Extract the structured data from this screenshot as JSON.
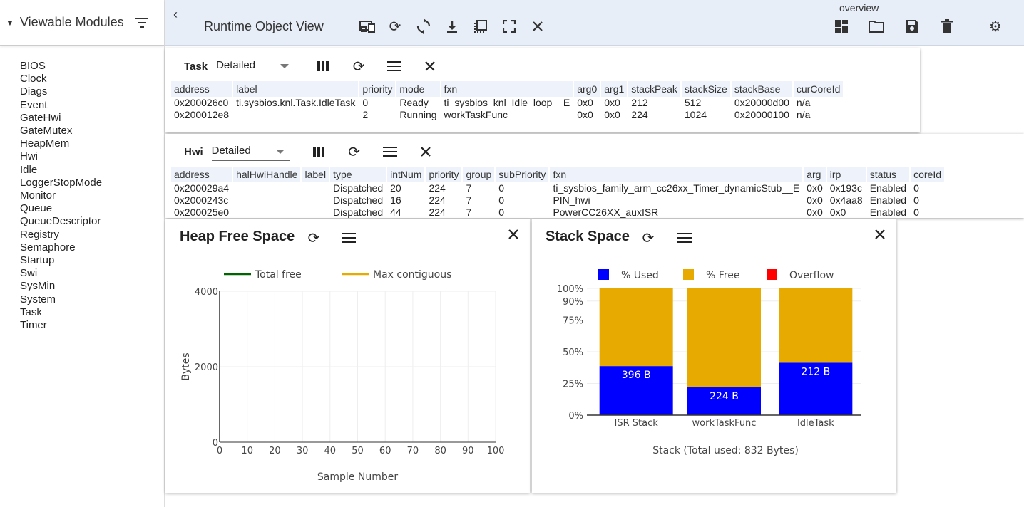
{
  "sidebar": {
    "title": "Viewable Modules",
    "modules": [
      "BIOS",
      "Clock",
      "Diags",
      "Event",
      "GateHwi",
      "GateMutex",
      "HeapMem",
      "Hwi",
      "Idle",
      "LoggerStopMode",
      "Monitor",
      "Queue",
      "QueueDescriptor",
      "Registry",
      "Semaphore",
      "Startup",
      "Swi",
      "SysMin",
      "System",
      "Task",
      "Timer"
    ]
  },
  "toolbar": {
    "back": "‹",
    "title": "Runtime Object View",
    "overview": "overview"
  },
  "task": {
    "name": "Task",
    "view": "Detailed",
    "columns": [
      "address",
      "label",
      "priority",
      "mode",
      "fxn",
      "arg0",
      "arg1",
      "stackPeak",
      "stackSize",
      "stackBase",
      "curCoreId"
    ],
    "rows": [
      [
        "0x200026c0",
        "ti.sysbios.knl.Task.IdleTask",
        "0",
        "Ready",
        "ti_sysbios_knl_Idle_loop__E",
        "0x0",
        "0x0",
        "212",
        "512",
        "0x20000d00",
        "n/a"
      ],
      [
        "0x200012e8",
        "",
        "2",
        "Running",
        "workTaskFunc",
        "0x0",
        "0x0",
        "224",
        "1024",
        "0x20000100",
        "n/a"
      ]
    ]
  },
  "hwi": {
    "name": "Hwi",
    "view": "Detailed",
    "columns": [
      "address",
      "halHwiHandle",
      "label",
      "type",
      "intNum",
      "priority",
      "group",
      "subPriority",
      "fxn",
      "arg",
      "irp",
      "status",
      "coreId"
    ],
    "rows": [
      [
        "0x200029a4",
        "",
        "",
        "Dispatched",
        "20",
        "224",
        "7",
        "0",
        "ti_sysbios_family_arm_cc26xx_Timer_dynamicStub__E",
        "0x0",
        "0x193c",
        "Enabled",
        "0"
      ],
      [
        "0x2000243c",
        "",
        "",
        "Dispatched",
        "16",
        "224",
        "7",
        "0",
        "PIN_hwi",
        "0x0",
        "0x4aa8",
        "Enabled",
        "0"
      ],
      [
        "0x200025e0",
        "",
        "",
        "Dispatched",
        "44",
        "224",
        "7",
        "0",
        "PowerCC26XX_auxISR",
        "0x0",
        "0x0",
        "Enabled",
        "0"
      ]
    ]
  },
  "heap": {
    "title": "Heap Free Space"
  },
  "stack": {
    "title": "Stack Space"
  },
  "colors": {
    "toolbar": "#e7eef8",
    "used": "#0000ff",
    "free": "#e6aa00",
    "overflow": "#ff0000",
    "total_free": "#006400",
    "max_contig": "#e6aa00"
  },
  "chart_data": [
    {
      "type": "line",
      "title": "",
      "xlabel": "Sample Number",
      "ylabel": "Bytes",
      "xlim": [
        0,
        100
      ],
      "ylim": [
        0,
        4000
      ],
      "xticks": [
        0,
        10,
        20,
        30,
        40,
        50,
        60,
        70,
        80,
        90,
        100
      ],
      "yticks": [
        0,
        2000,
        4000
      ],
      "grid": true,
      "legend_position": "top",
      "series": [
        {
          "name": "Total free",
          "color": "#006400",
          "x": [],
          "y": []
        },
        {
          "name": "Max contiguous",
          "color": "#e6aa00",
          "x": [],
          "y": []
        }
      ]
    },
    {
      "type": "bar",
      "stacked": true,
      "title": "",
      "xlabel": "Stack (Total used: 832 Bytes)",
      "ylabel": "",
      "categories": [
        "ISR Stack",
        "workTaskFunc",
        "IdleTask"
      ],
      "ylim": [
        0,
        100
      ],
      "yticks": [
        0,
        25,
        50,
        75,
        90,
        100
      ],
      "ytick_labels": [
        "0%",
        "25%",
        "50%",
        "75%",
        "90%",
        "100%"
      ],
      "legend_position": "top",
      "series": [
        {
          "name": "% Used",
          "color": "#0000ff",
          "values": [
            38.7,
            21.9,
            41.4
          ],
          "labels": [
            "396 B",
            "224 B",
            "212 B"
          ]
        },
        {
          "name": "% Free",
          "color": "#e6aa00",
          "values": [
            61.3,
            78.1,
            58.6
          ]
        },
        {
          "name": "Overflow",
          "color": "#ff0000",
          "values": [
            0,
            0,
            0
          ]
        }
      ]
    }
  ]
}
